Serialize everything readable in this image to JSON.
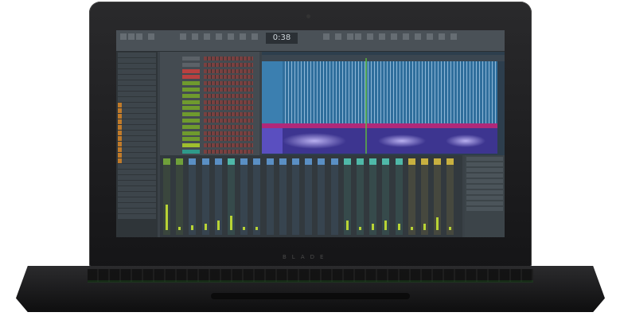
{
  "device": {
    "logo_text": "BLADE"
  },
  "daw": {
    "toolbar": {
      "time": "0:38"
    },
    "colors": {
      "accent_green": "#b8d335",
      "playlist_blue": "#2f6e9c",
      "audio_purple": "#4b3fa0",
      "automation_magenta": "#b0287a",
      "mixer_yellow": "#8a7a2a",
      "mixer_teal": "#2a8a7a"
    },
    "channel_colors": [
      "#5c6268",
      "#5c6268",
      "#b94040",
      "#b94040",
      "#6f9a2e",
      "#6f9a2e",
      "#6f9a2e",
      "#6f9a2e",
      "#6f9a2e",
      "#6f9a2e",
      "#6f9a2e",
      "#6f9a2e",
      "#6f9a2e",
      "#6f9a2e",
      "#9fbf2e",
      "#2f9a8a"
    ],
    "mixer_groups": [
      "#6fa03a",
      "#6fa03a",
      "#5a8fc4",
      "#5a8fc4",
      "#5a8fc4",
      "#4fb8a8",
      "#5a8fc4",
      "#5a8fc4",
      "#5a8fc4",
      "#5a8fc4",
      "#5a8fc4",
      "#5a8fc4",
      "#5a8fc4",
      "#5a8fc4",
      "#4fb8a8",
      "#4fb8a8",
      "#4fb8a8",
      "#4fb8a8",
      "#4fb8a8",
      "#c8b040",
      "#c8b040",
      "#c8b040",
      "#c8b040"
    ],
    "mixer_levels": [
      0.8,
      0.1,
      0.15,
      0.2,
      0.3,
      0.45,
      0.1,
      0.1,
      0.0,
      0.0,
      0.0,
      0.0,
      0.0,
      0.0,
      0.3,
      0.1,
      0.2,
      0.3,
      0.2,
      0.1,
      0.2,
      0.4,
      0.1
    ]
  }
}
